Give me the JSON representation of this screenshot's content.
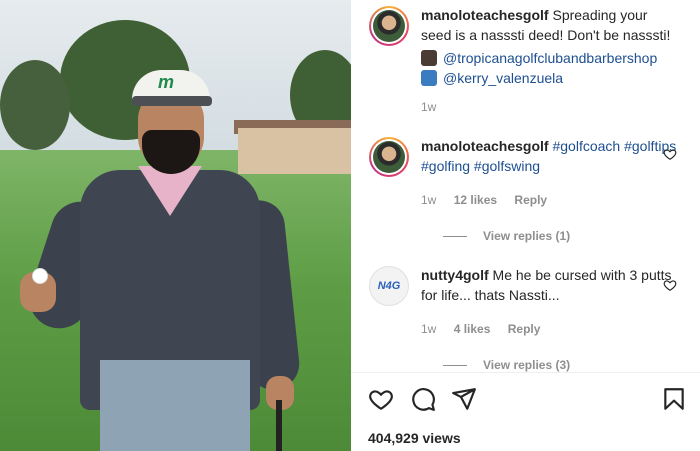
{
  "post": {
    "author": "manoloteachesgolf",
    "caption": "Spreading your seed is a nasssti deed! Don't be nasssti!",
    "mentions": [
      "@tropicanagolfclubandbarbershop",
      "@kerry_valenzuela"
    ],
    "time": "1w"
  },
  "comments": [
    {
      "username": "manoloteachesgolf",
      "tags": "#golfcoach #golftips #golfing #golfswing",
      "time": "1w",
      "likes": "12 likes",
      "reply": "Reply",
      "view_replies": "View replies (1)"
    },
    {
      "username": "nutty4golf",
      "text": "Me he be cursed with 3 putts for life... thats Nassti...",
      "time": "1w",
      "likes": "4 likes",
      "reply": "Reply",
      "view_replies": "View replies (3)",
      "avatar_text": "N4G"
    }
  ],
  "video": {
    "cap_logo": "m"
  },
  "footer": {
    "views": "404,929 views"
  },
  "icons": {
    "like": "heart-icon",
    "comment": "comment-icon",
    "share": "paper-plane-icon",
    "save": "bookmark-icon"
  },
  "colors": {
    "link": "#1d4f91",
    "muted": "#8e8e8e",
    "text": "#262626"
  }
}
